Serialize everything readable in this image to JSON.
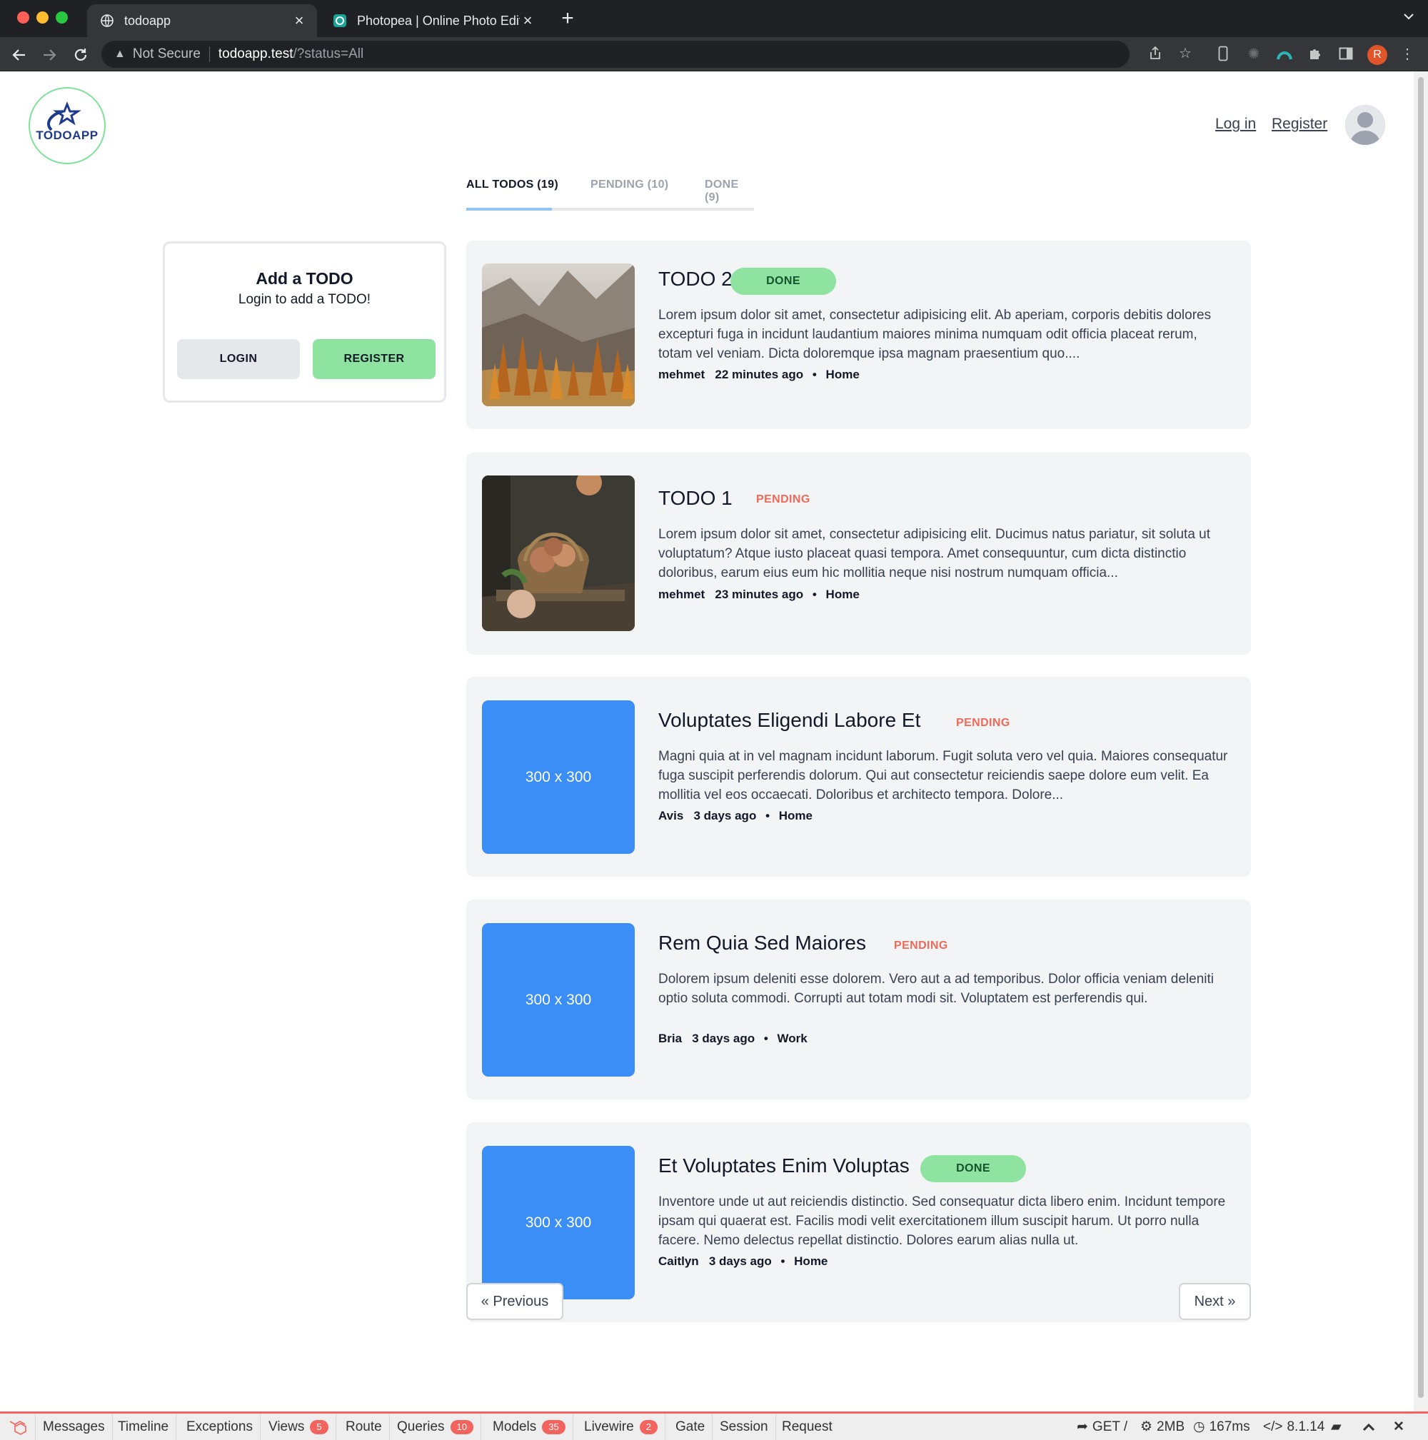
{
  "browser": {
    "tabs": [
      {
        "title": "todoapp",
        "active": true
      },
      {
        "title": "Photopea | Online Photo Editor",
        "active": false
      }
    ],
    "address": {
      "security_label": "Not Secure",
      "host": "todoapp.test",
      "path": "/?status=All"
    },
    "profile_initial": "R"
  },
  "header": {
    "logo_text": "TODOAPP",
    "login_link": "Log in",
    "register_link": "Register"
  },
  "filter_tabs": [
    {
      "label": "ALL TODOS (19)",
      "active": true
    },
    {
      "label": "PENDING (10)",
      "active": false
    },
    {
      "label": "DONE (9)",
      "active": false
    }
  ],
  "add_box": {
    "heading": "Add a TODO",
    "subheading": "Login to add a TODO!",
    "login_button": "LOGIN",
    "register_button": "REGISTER"
  },
  "todos": [
    {
      "title": "TODO 2",
      "status": "DONE",
      "image": "autumn mountain photo",
      "body": "Lorem ipsum dolor sit amet, consectetur adipisicing elit. Ab aperiam, corporis debitis dolores excepturi fuga in incidunt laudantium maiores minima numquam odit officia placeat rerum, totam vel veniam. Dicta doloremque ipsa magnam praesentium quo....",
      "author": "mehmet",
      "time": "22 minutes ago",
      "category": "Home"
    },
    {
      "title": "TODO 1",
      "status": "PENDING",
      "image": "onion basket photo",
      "body": "Lorem ipsum dolor sit amet, consectetur adipisicing elit. Ducimus natus pariatur, sit soluta ut voluptatum? Atque iusto placeat quasi tempora. Amet consequuntur, cum dicta distinctio doloribus, earum eius eum hic mollitia neque nisi nostrum numquam officia...",
      "author": "mehmet",
      "time": "23 minutes ago",
      "category": "Home"
    },
    {
      "title": "Voluptates Eligendi Labore Et",
      "status": "PENDING",
      "image": "300 x 300",
      "body": "Magni quia at in vel magnam incidunt laborum. Fugit soluta vero vel quia. Maiores consequatur fuga suscipit perferendis dolorum. Qui aut consectetur reiciendis saepe dolore eum velit. Ea mollitia vel eos occaecati. Doloribus et architecto tempora. Dolore...",
      "author": "Avis",
      "time": "3 days ago",
      "category": "Home"
    },
    {
      "title": "Rem Quia Sed Maiores",
      "status": "PENDING",
      "image": "300 x 300",
      "body": "Dolorem ipsum deleniti esse dolorem. Vero aut a ad temporibus. Dolor officia veniam deleniti optio soluta commodi. Corrupti aut totam modi sit. Voluptatem est perferendis qui.",
      "author": "Bria",
      "time": "3 days ago",
      "category": "Work"
    },
    {
      "title": "Et Voluptates Enim Voluptas",
      "status": "DONE",
      "image": "300 x 300",
      "body": "Inventore unde ut aut reiciendis distinctio. Sed consequatur dicta libero enim. Incidunt tempore ipsam qui quaerat est. Facilis modi velit exercitationem illum suscipit harum. Ut porro nulla facere. Nemo delectus repellat distinctio. Dolores earum alias nulla ut.",
      "author": "Caitlyn",
      "time": "3 days ago",
      "category": "Home"
    }
  ],
  "pagination": {
    "previous": "« Previous",
    "next": "Next »"
  },
  "debugbar": {
    "tabs": [
      {
        "label": "Messages"
      },
      {
        "label": "Timeline"
      },
      {
        "label": "Exceptions"
      },
      {
        "label": "Views",
        "badge": "5"
      },
      {
        "label": "Route"
      },
      {
        "label": "Queries",
        "badge": "10"
      },
      {
        "label": "Models",
        "badge": "35"
      },
      {
        "label": "Livewire",
        "badge": "2"
      },
      {
        "label": "Gate"
      },
      {
        "label": "Session"
      },
      {
        "label": "Request"
      }
    ],
    "method": "GET /",
    "memory": "2MB",
    "duration": "167ms",
    "php_version": "8.1.14"
  },
  "colors": {
    "done_badge": "#8ee3a1",
    "pending_text": "#ef6a5a",
    "placeholder_blue": "#3a8ef6",
    "debugbar_accent": "#f4645f"
  }
}
